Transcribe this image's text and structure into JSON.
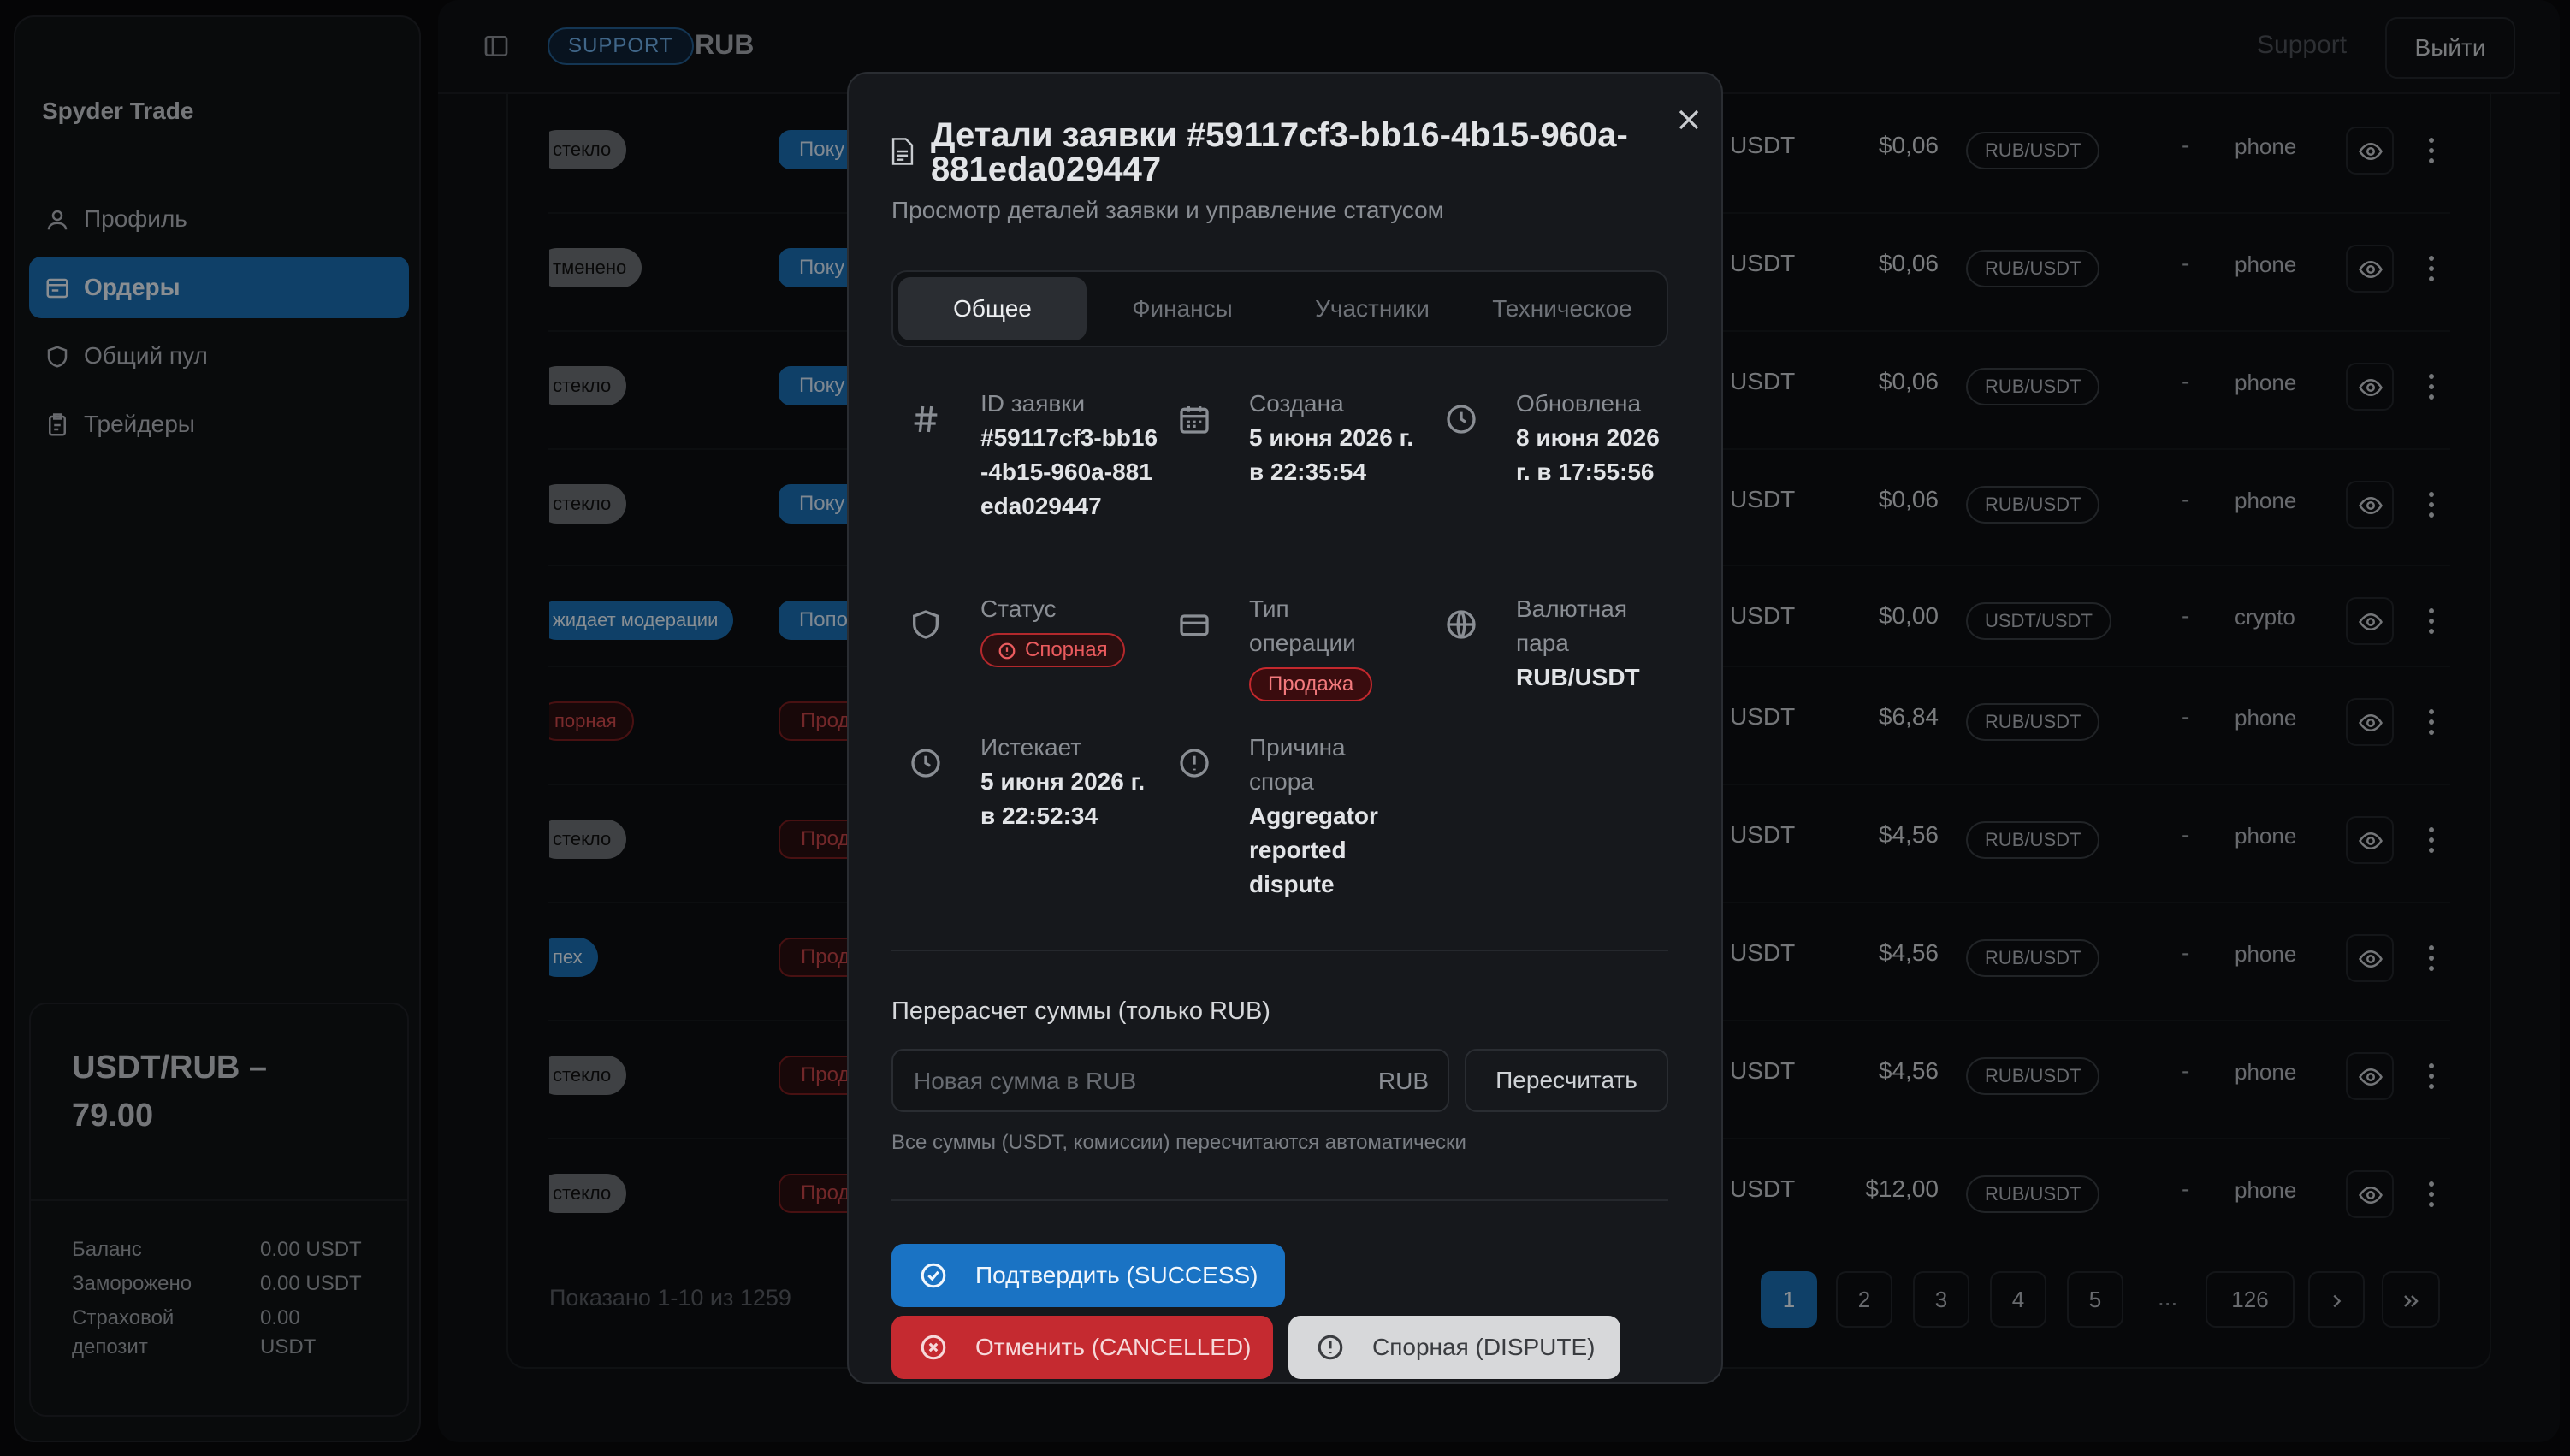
{
  "app": {
    "brand": "Spyder Trade"
  },
  "sidebar": {
    "items": [
      {
        "label": "Профиль",
        "icon": "user-icon"
      },
      {
        "label": "Ордеры",
        "icon": "orders-icon",
        "active": true
      },
      {
        "label": "Общий пул",
        "icon": "shield-icon"
      },
      {
        "label": "Трейдеры",
        "icon": "traders-icon"
      }
    ],
    "rate": {
      "title": "USDT/RUB – 79.00",
      "rows": [
        {
          "label": "Баланс",
          "value": "0.00 USDT"
        },
        {
          "label": "Заморожено",
          "value": "0.00 USDT"
        },
        {
          "label": "Страховой депозит",
          "value": "0.00 USDT"
        }
      ]
    }
  },
  "header": {
    "role_badge": "SUPPORT",
    "currency": "RUB",
    "support_link": "Support",
    "logout": "Выйти"
  },
  "colors": {
    "accent": "#1a6fb3",
    "danger": "#c52a30",
    "background": "#0e1013"
  },
  "table": {
    "rows": [
      {
        "status": "стекло",
        "status_style": "grey",
        "type": "Поку",
        "type_style": "blue",
        "currency": "USDT",
        "amount": "$0,06",
        "pair": "RUB/USDT",
        "dash": "-",
        "method": "phone"
      },
      {
        "status": "тменено",
        "status_style": "grey",
        "type": "Поку",
        "type_style": "blue",
        "currency": "USDT",
        "amount": "$0,06",
        "pair": "RUB/USDT",
        "dash": "-",
        "method": "phone"
      },
      {
        "status": "стекло",
        "status_style": "grey",
        "type": "Поку",
        "type_style": "blue",
        "currency": "USDT",
        "amount": "$0,06",
        "pair": "RUB/USDT",
        "dash": "-",
        "method": "phone"
      },
      {
        "status": "стекло",
        "status_style": "grey",
        "type": "Поку",
        "type_style": "blue",
        "currency": "USDT",
        "amount": "$0,06",
        "pair": "RUB/USDT",
        "dash": "-",
        "method": "phone"
      },
      {
        "status": "жидает модерации",
        "status_style": "blue",
        "type": "Попо",
        "type_style": "blue",
        "currency": "USDT",
        "amount": "$0,00",
        "pair": "USDT/USDT",
        "dash": "-",
        "method": "crypto"
      },
      {
        "status": "порная",
        "status_style": "red",
        "type": "Прод",
        "type_style": "red",
        "currency": "USDT",
        "amount": "$6,84",
        "pair": "RUB/USDT",
        "dash": "-",
        "method": "phone"
      },
      {
        "status": "стекло",
        "status_style": "grey",
        "type": "Прод",
        "type_style": "red",
        "currency": "USDT",
        "amount": "$4,56",
        "pair": "RUB/USDT",
        "dash": "-",
        "method": "phone"
      },
      {
        "status": "пех",
        "status_style": "blue",
        "type": "Прод",
        "type_style": "red",
        "currency": "USDT",
        "amount": "$4,56",
        "pair": "RUB/USDT",
        "dash": "-",
        "method": "phone"
      },
      {
        "status": "стекло",
        "status_style": "grey",
        "type": "Прод",
        "type_style": "red",
        "currency": "USDT",
        "amount": "$4,56",
        "pair": "RUB/USDT",
        "dash": "-",
        "method": "phone"
      },
      {
        "status": "стекло",
        "status_style": "grey",
        "type": "Прод",
        "type_style": "red",
        "currency": "USDT",
        "amount": "$12,00",
        "pair": "RUB/USDT",
        "dash": "-",
        "method": "phone"
      }
    ],
    "shown_text": "Показано 1-10 из 1259",
    "pagination": {
      "pages": [
        "1",
        "2",
        "3",
        "4",
        "5"
      ],
      "ellipsis": "...",
      "last": "126",
      "current": "1"
    }
  },
  "modal": {
    "title": "Детали заявки #59117cf3-bb16-4b15-960a-881eda029447",
    "subtitle": "Просмотр деталей заявки и управление статусом",
    "tabs": [
      "Общее",
      "Финансы",
      "Участники",
      "Техническое"
    ],
    "active_tab": "Общее",
    "fields": {
      "id": {
        "label": "ID заявки",
        "value": "#59117cf3-bb16-4b15-960a-881eda029447"
      },
      "created": {
        "label": "Создана",
        "value": "5 июня 2026 г. в 22:35:54"
      },
      "updated": {
        "label": "Обновлена",
        "value": "8 июня 2026 г. в 17:55:56"
      },
      "status": {
        "label": "Статус",
        "value": "Спорная"
      },
      "op_type": {
        "label": "Тип операции",
        "value": "Продажа"
      },
      "pair": {
        "label": "Валютная пара",
        "value": "RUB/USDT"
      },
      "expires": {
        "label": "Истекает",
        "value": "5 июня 2026 г. в 22:52:34"
      },
      "reason": {
        "label": "Причина спора",
        "value": "Aggregator reported dispute"
      }
    },
    "recalc": {
      "title": "Перерасчет суммы (только RUB)",
      "placeholder": "Новая сумма в RUB",
      "suffix": "RUB",
      "button": "Пересчитать",
      "note": "Все суммы (USDT, комиссии) пересчитаются автоматически"
    },
    "actions": {
      "confirm": "Подтвердить (SUCCESS)",
      "cancel": "Отменить (CANCELLED)",
      "dispute": "Спорная (DISPUTE)"
    }
  }
}
